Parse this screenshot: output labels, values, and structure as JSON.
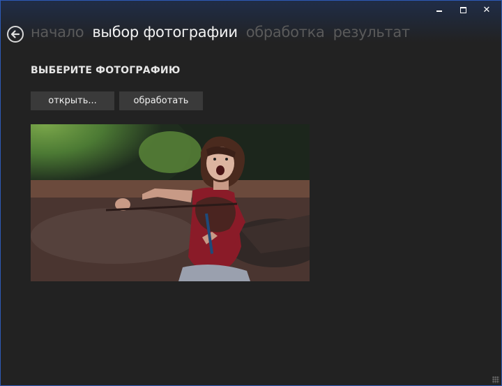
{
  "nav": {
    "steps": [
      "начало",
      "выбор фотографии",
      "обработка",
      "результат"
    ],
    "active_index": 1
  },
  "content": {
    "title": "ВЫБЕРИТЕ ФОТОГРАФИЮ",
    "open_button": "открыть...",
    "process_button": "обработать"
  },
  "colors": {
    "background": "#222222",
    "button": "#3a3a3a",
    "inactive_text": "#5a5a5a",
    "active_text": "#f2f2f2",
    "window_border": "#2d5bb8"
  },
  "icons": {
    "back": "back-arrow-icon",
    "minimize": "minimize-icon",
    "maximize": "maximize-icon",
    "close": "close-icon"
  }
}
